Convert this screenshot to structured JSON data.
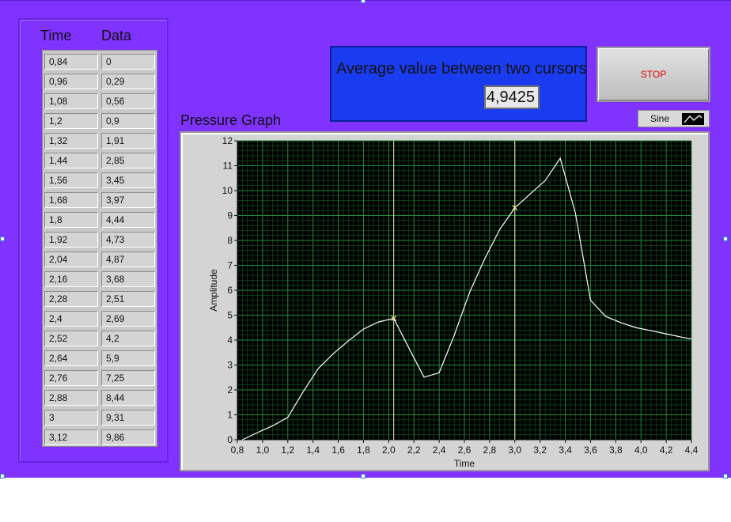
{
  "table": {
    "headers": {
      "time": "Time",
      "data": "Data"
    },
    "rows": [
      [
        "0,84",
        "0"
      ],
      [
        "0,96",
        "0,29"
      ],
      [
        "1,08",
        "0,56"
      ],
      [
        "1,2",
        "0,9"
      ],
      [
        "1,32",
        "1,91"
      ],
      [
        "1,44",
        "2,85"
      ],
      [
        "1,56",
        "3,45"
      ],
      [
        "1,68",
        "3,97"
      ],
      [
        "1,8",
        "4,44"
      ],
      [
        "1,92",
        "4,73"
      ],
      [
        "2,04",
        "4,87"
      ],
      [
        "2,16",
        "3,68"
      ],
      [
        "2,28",
        "2,51"
      ],
      [
        "2,4",
        "2,69"
      ],
      [
        "2,52",
        "4,2"
      ],
      [
        "2,64",
        "5,9"
      ],
      [
        "2,76",
        "7,25"
      ],
      [
        "2,88",
        "8,44"
      ],
      [
        "3",
        "9,31"
      ],
      [
        "3,12",
        "9,86"
      ]
    ]
  },
  "average": {
    "label": "Average value between two cursors",
    "value": "4,9425"
  },
  "stop_button": {
    "label": "STOP"
  },
  "legend": {
    "label": "Sine"
  },
  "graph": {
    "title": "Pressure Graph"
  },
  "colors": {
    "panel": "#8033ff",
    "plot_bg": "#000000",
    "grid": "#1f8a3a",
    "trace": "#ffffff",
    "cursor": "#f5f59c",
    "stop_text": "#e00000",
    "avg_box": "#1a3cf0"
  },
  "chart_data": {
    "type": "line",
    "title": "Pressure Graph",
    "xlabel": "Time",
    "ylabel": "Amplitude",
    "xlim": [
      0.8,
      4.4
    ],
    "ylim": [
      0,
      12
    ],
    "x_ticks": [
      "0,8",
      "1,0",
      "1,2",
      "1,4",
      "1,6",
      "1,8",
      "2,0",
      "2,2",
      "2,4",
      "2,6",
      "2,8",
      "3,0",
      "3,2",
      "3,4",
      "3,6",
      "3,8",
      "4,0",
      "4,2",
      "4,4"
    ],
    "y_ticks": [
      "0",
      "1",
      "2",
      "3",
      "4",
      "5",
      "6",
      "7",
      "8",
      "9",
      "10",
      "11",
      "12"
    ],
    "grid": true,
    "series": [
      {
        "name": "Sine",
        "x": [
          0.84,
          0.96,
          1.08,
          1.2,
          1.32,
          1.44,
          1.56,
          1.68,
          1.8,
          1.92,
          2.04,
          2.16,
          2.28,
          2.4,
          2.52,
          2.64,
          2.76,
          2.88,
          3.0,
          3.12,
          3.24,
          3.36,
          3.48,
          3.6,
          3.72,
          3.84,
          3.96,
          4.08,
          4.2,
          4.32,
          4.4
        ],
        "y": [
          0,
          0.29,
          0.56,
          0.9,
          1.91,
          2.85,
          3.45,
          3.97,
          4.44,
          4.73,
          4.87,
          3.68,
          2.51,
          2.69,
          4.2,
          5.9,
          7.25,
          8.44,
          9.31,
          9.86,
          10.4,
          11.3,
          9.1,
          5.6,
          4.95,
          4.7,
          4.5,
          4.38,
          4.25,
          4.12,
          4.05
        ]
      }
    ],
    "cursors": [
      2.04,
      3.0
    ]
  }
}
